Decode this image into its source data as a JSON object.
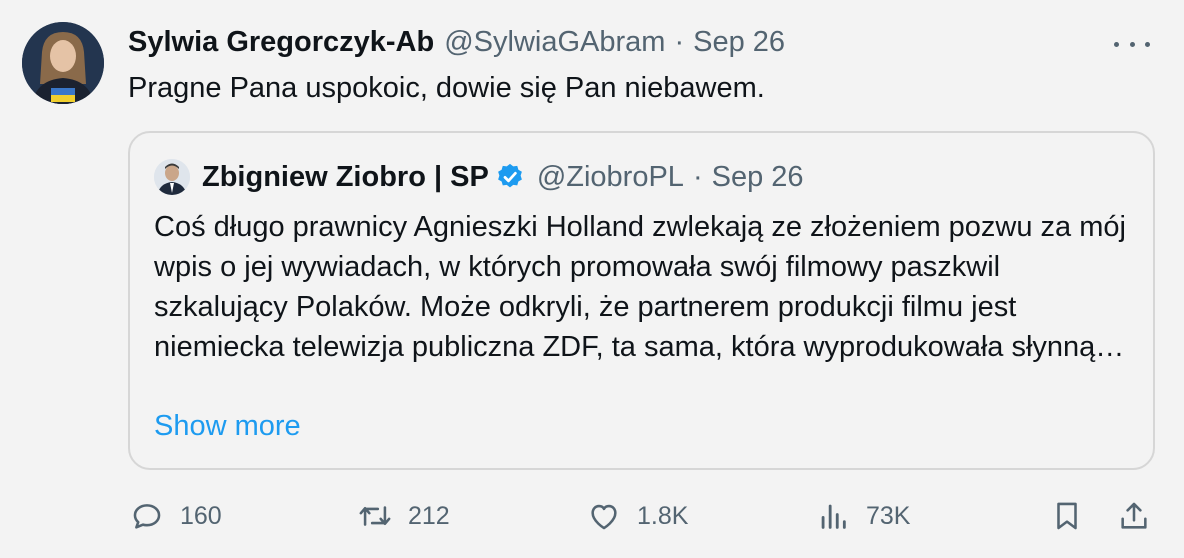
{
  "tweet": {
    "author": {
      "name": "Sylwia Gregorczyk-Ab",
      "handle": "@SylwiaGAbram",
      "separator": "·",
      "time": "Sep 26"
    },
    "text": "Pragne Pana uspokoic, dowie się Pan niebawem.",
    "quote": {
      "name": "Zbigniew Ziobro | SP",
      "handle": "@ZiobroPL",
      "separator": "·",
      "time": "Sep 26",
      "text": "Coś długo prawnicy Agnieszki Holland zwlekają ze złożeniem pozwu za mój wpis o jej wywiadach, w których promowała swój filmowy paszkwil szkalujący Polaków. Może odkryli, że partnerem produkcji filmu jest niemiecka telewizja publiczna ZDF, ta sama, która wyprodukowała słynną…",
      "show_more": "Show more"
    },
    "actions": {
      "replies": "160",
      "retweets": "212",
      "likes": "1.8K",
      "views": "73K"
    }
  },
  "colors": {
    "secondary_text": "#536471",
    "link": "#1d9bf0",
    "verified": "#1d9bf0",
    "background": "#f3f3f3",
    "border": "#d6d6d6"
  },
  "icons": {
    "reply": "reply-icon",
    "retweet": "retweet-icon",
    "like": "like-icon",
    "views": "views-icon",
    "bookmark": "bookmark-icon",
    "share": "share-icon",
    "more": "more-icon",
    "verified": "verified-badge-icon"
  }
}
